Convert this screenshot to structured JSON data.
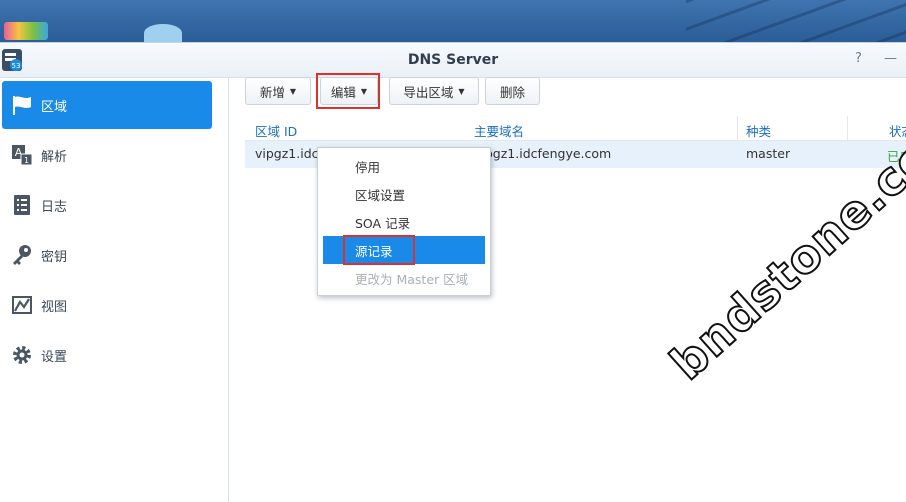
{
  "window": {
    "title": "DNS Server",
    "help_symbol": "?",
    "minimize_symbol": "—"
  },
  "app_logo": {
    "badge": "53"
  },
  "sidebar": {
    "items": [
      {
        "label": "区域",
        "icon": "flag-icon",
        "active": true
      },
      {
        "label": "解析",
        "icon": "resolve-icon",
        "active": false
      },
      {
        "label": "日志",
        "icon": "log-icon",
        "active": false
      },
      {
        "label": "密钥",
        "icon": "key-icon",
        "active": false
      },
      {
        "label": "视图",
        "icon": "view-icon",
        "active": false
      },
      {
        "label": "设置",
        "icon": "gear-icon",
        "active": false
      }
    ]
  },
  "toolbar": {
    "create_label": "新增",
    "edit_label": "编辑",
    "export_label": "导出区域",
    "delete_label": "删除"
  },
  "grid": {
    "columns": [
      "区域 ID",
      "主要域名",
      "种类",
      "状态"
    ],
    "rows": [
      {
        "zone_id": "vipgz1.idcf",
        "domain": "vipgz1.idcfengye.com",
        "type": "master",
        "status": "已启"
      }
    ]
  },
  "menu": {
    "items": [
      {
        "label": "停用",
        "state": "normal"
      },
      {
        "label": "区域设置",
        "state": "normal"
      },
      {
        "label": "SOA 记录",
        "state": "normal"
      },
      {
        "label": "源记录",
        "state": "active"
      },
      {
        "label": "更改为 Master 区域",
        "state": "disabled"
      }
    ]
  },
  "watermark": "bndstone.com",
  "colors": {
    "accent": "#1a8ae8",
    "highlight_box": "#e0302e",
    "status_ok": "#3aa13a"
  }
}
